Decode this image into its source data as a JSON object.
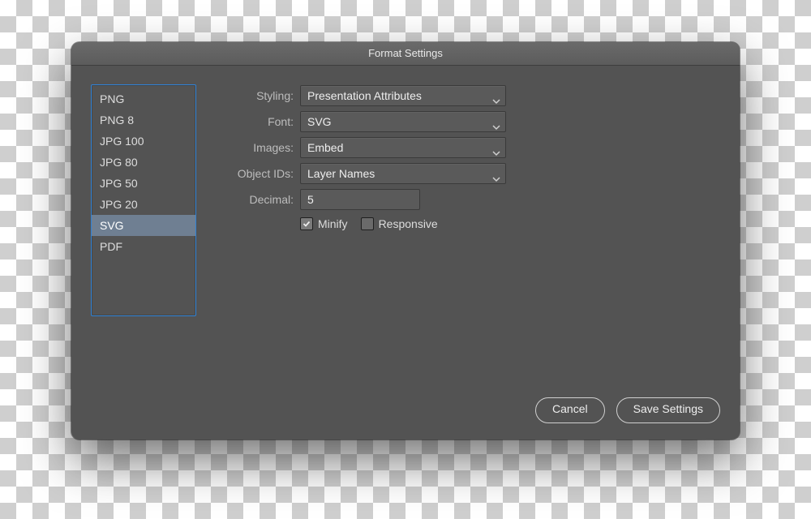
{
  "window": {
    "title": "Format Settings"
  },
  "formats": {
    "items": [
      "PNG",
      "PNG 8",
      "JPG 100",
      "JPG 80",
      "JPG 50",
      "JPG 20",
      "SVG",
      "PDF"
    ],
    "selected_index": 6
  },
  "form": {
    "styling": {
      "label": "Styling:",
      "value": "Presentation Attributes"
    },
    "font": {
      "label": "Font:",
      "value": "SVG"
    },
    "images": {
      "label": "Images:",
      "value": "Embed"
    },
    "object_ids": {
      "label": "Object IDs:",
      "value": "Layer Names"
    },
    "decimal": {
      "label": "Decimal:",
      "value": "5"
    },
    "minify": {
      "label": "Minify",
      "checked": true
    },
    "responsive": {
      "label": "Responsive",
      "checked": false
    }
  },
  "buttons": {
    "cancel": "Cancel",
    "save": "Save Settings"
  }
}
